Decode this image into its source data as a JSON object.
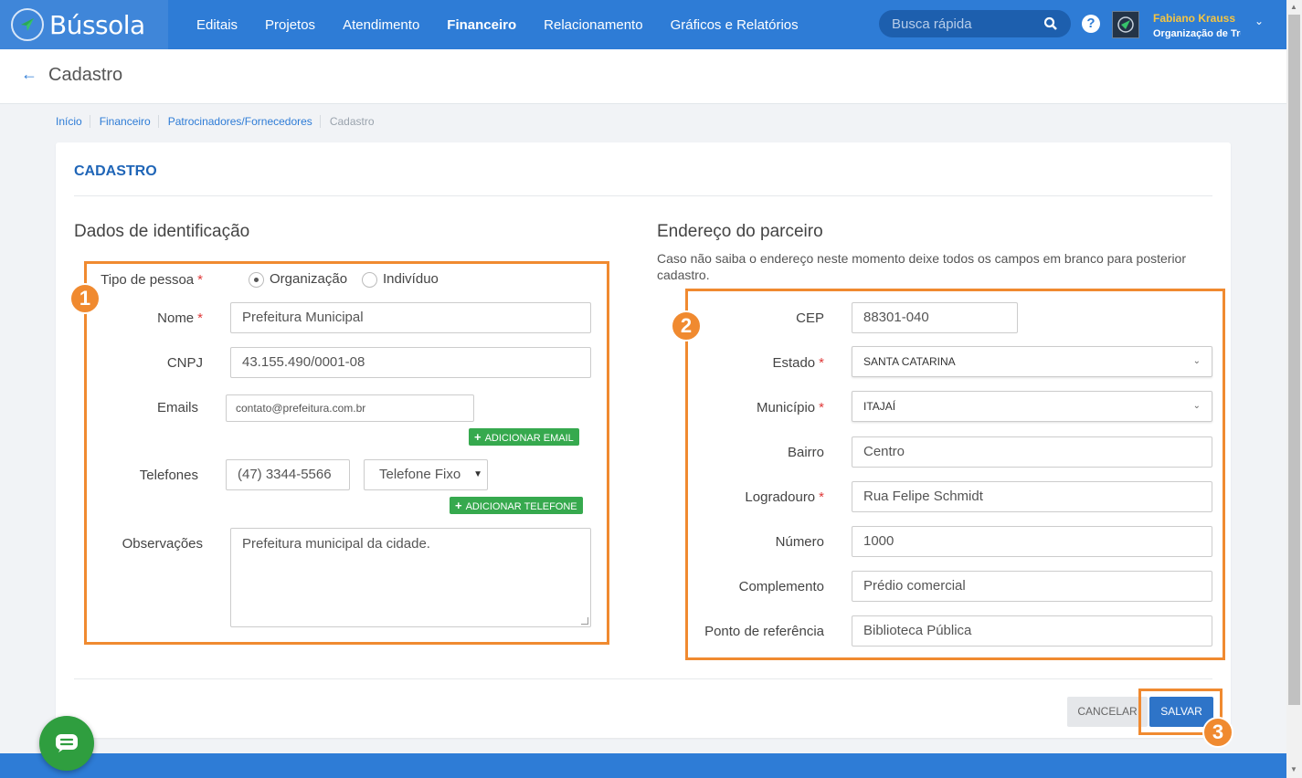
{
  "app": {
    "name": "Bússola"
  },
  "nav": {
    "items": [
      {
        "label": "Editais"
      },
      {
        "label": "Projetos"
      },
      {
        "label": "Atendimento"
      },
      {
        "label": "Financeiro"
      },
      {
        "label": "Relacionamento"
      },
      {
        "label": "Gráficos e Relatórios"
      }
    ],
    "active": "Financeiro"
  },
  "search": {
    "placeholder": "Busca rápida"
  },
  "user": {
    "name": "Fabiano Krauss",
    "org": "Organização de Tre"
  },
  "page": {
    "title": "Cadastro"
  },
  "breadcrumb": [
    {
      "label": "Início"
    },
    {
      "label": "Financeiro"
    },
    {
      "label": "Patrocinadores/Fornecedores"
    },
    {
      "label": "Cadastro"
    }
  ],
  "card": {
    "title": "CADASTRO"
  },
  "ident": {
    "title": "Dados de identificação",
    "badge": "1",
    "tipo_label": "Tipo de pessoa",
    "options": [
      "Organização",
      "Indivíduo"
    ],
    "selected": "Organização",
    "nome_label": "Nome",
    "nome_value": "Prefeitura Municipal",
    "cnpj_label": "CNPJ",
    "cnpj_value": "43.155.490/0001-08",
    "emails_label": "Emails",
    "email_value": "contato@prefeitura.com.br",
    "add_email": "ADICIONAR EMAIL",
    "telefones_label": "Telefones",
    "telefone_value": "(47) 3344-5566",
    "telefone_tipo": "Telefone Fixo",
    "add_telefone": "ADICIONAR TELEFONE",
    "obs_label": "Observações",
    "obs_value": "Prefeitura municipal da cidade."
  },
  "endereco": {
    "title": "Endereço do parceiro",
    "desc": "Caso não saiba o endereço neste momento deixe todos os campos em branco para posterior cadastro.",
    "badge": "2",
    "cep_label": "CEP",
    "cep_value": "88301-040",
    "estado_label": "Estado",
    "estado_value": "SANTA CATARINA",
    "municipio_label": "Município",
    "municipio_value": "ITAJAÍ",
    "bairro_label": "Bairro",
    "bairro_value": "Centro",
    "logradouro_label": "Logradouro",
    "logradouro_value": "Rua Felipe Schmidt",
    "numero_label": "Número",
    "numero_value": "1000",
    "complemento_label": "Complemento",
    "complemento_value": "Prédio comercial",
    "referencia_label": "Ponto de referência",
    "referencia_value": "Biblioteca Pública"
  },
  "actions": {
    "cancel": "CANCELAR",
    "save": "SALVAR",
    "badge": "3"
  },
  "required_mark": "*",
  "icons": {
    "logo": "compass-icon",
    "search": "search-icon",
    "help": "help-icon",
    "back": "arrow-left-icon",
    "chat": "chat-icon",
    "add": "plus-icon",
    "dropdown": "chevron-down-icon"
  },
  "colors": {
    "primary": "#2e7cd6",
    "highlight": "#f08a30",
    "success": "#36a94e",
    "user_name": "#f5c542"
  }
}
